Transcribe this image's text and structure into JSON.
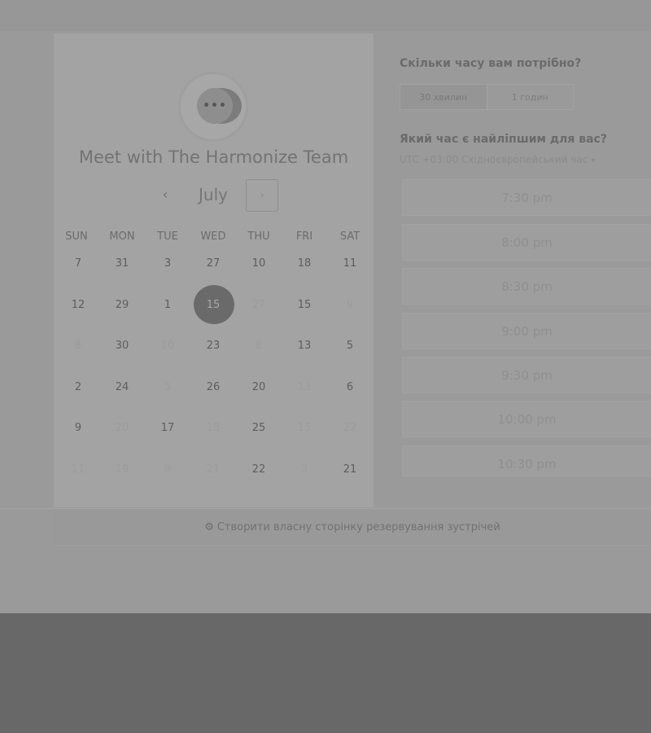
{
  "calendar": {
    "title": "Meet with The Harmonize Team",
    "month": "July",
    "prev_icon": "‹",
    "next_icon": "›",
    "weekdays": [
      "SUN",
      "MON",
      "TUE",
      "WED",
      "THU",
      "FRI",
      "SAT"
    ],
    "weeks": [
      [
        {
          "t": "7",
          "s": "active"
        },
        {
          "t": "31",
          "s": "active"
        },
        {
          "t": "3",
          "s": "active"
        },
        {
          "t": "27",
          "s": "active"
        },
        {
          "t": "10",
          "s": "active"
        },
        {
          "t": "18",
          "s": "active"
        },
        {
          "t": "11",
          "s": "active"
        }
      ],
      [
        {
          "t": "12",
          "s": "active"
        },
        {
          "t": "29",
          "s": "active"
        },
        {
          "t": "1",
          "s": "active"
        },
        {
          "t": "15",
          "s": "selected"
        },
        {
          "t": "27",
          "s": "muted"
        },
        {
          "t": "15",
          "s": "active"
        },
        {
          "t": "9",
          "s": "muted"
        }
      ],
      [
        {
          "t": "8",
          "s": "muted"
        },
        {
          "t": "30",
          "s": "active"
        },
        {
          "t": "10",
          "s": "muted"
        },
        {
          "t": "23",
          "s": "active"
        },
        {
          "t": "8",
          "s": "muted"
        },
        {
          "t": "13",
          "s": "active"
        },
        {
          "t": "5",
          "s": "active"
        }
      ],
      [
        {
          "t": "2",
          "s": "active"
        },
        {
          "t": "24",
          "s": "active"
        },
        {
          "t": "5",
          "s": "muted"
        },
        {
          "t": "26",
          "s": "active"
        },
        {
          "t": "20",
          "s": "active"
        },
        {
          "t": "13",
          "s": "muted"
        },
        {
          "t": "6",
          "s": "active"
        }
      ],
      [
        {
          "t": "9",
          "s": "active"
        },
        {
          "t": "20",
          "s": "muted"
        },
        {
          "t": "17",
          "s": "active"
        },
        {
          "t": "18",
          "s": "muted"
        },
        {
          "t": "25",
          "s": "active"
        },
        {
          "t": "15",
          "s": "muted"
        },
        {
          "t": "22",
          "s": "muted"
        }
      ],
      [
        {
          "t": "11",
          "s": "muted"
        },
        {
          "t": "19",
          "s": "muted"
        },
        {
          "t": "9",
          "s": "muted"
        },
        {
          "t": "21",
          "s": "muted"
        },
        {
          "t": "22",
          "s": "active"
        },
        {
          "t": "3",
          "s": "muted"
        },
        {
          "t": "21",
          "s": "active"
        }
      ]
    ]
  },
  "duration": {
    "heading": "Скільки часу вам потрібно?",
    "options": [
      "30 хвилин",
      "1 годин"
    ],
    "selected_index": 0
  },
  "time": {
    "heading": "Який час є найліпшим для вас?",
    "timezone": "UTC +03:00 Східноєвропейський час",
    "timezone_caret": "▾",
    "slots": [
      "7:30 pm",
      "8:00 pm",
      "8:30 pm",
      "9:00 pm",
      "9:30 pm",
      "10:00 pm",
      "10:30 pm"
    ]
  },
  "footer": {
    "icon": "sprocket-icon",
    "text": "Створити власну сторінку резервування зустрічей"
  }
}
